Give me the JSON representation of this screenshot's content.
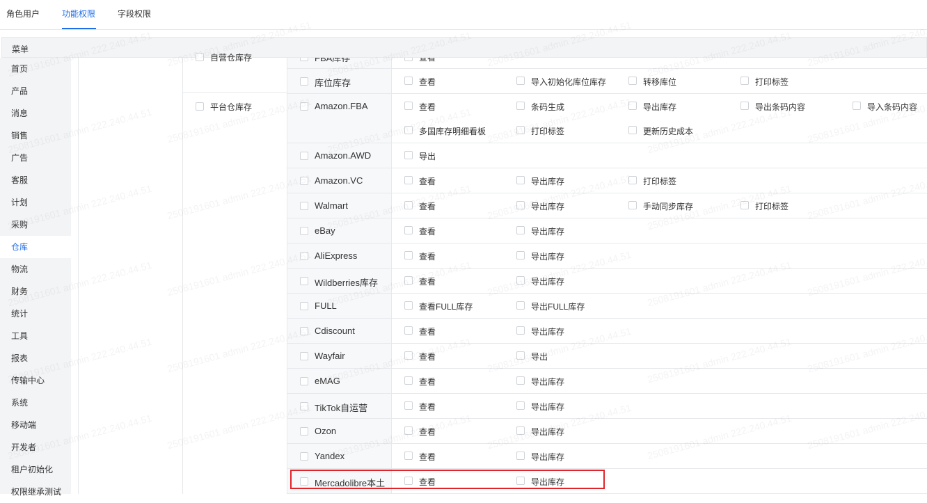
{
  "tabs": [
    {
      "label": "角色用户"
    },
    {
      "label": "功能权限"
    },
    {
      "label": "字段权限"
    }
  ],
  "menu_header": "菜单",
  "sidebar": {
    "items": [
      {
        "label": "首页"
      },
      {
        "label": "产品"
      },
      {
        "label": "消息"
      },
      {
        "label": "销售"
      },
      {
        "label": "广告"
      },
      {
        "label": "客服"
      },
      {
        "label": "计划"
      },
      {
        "label": "采购"
      },
      {
        "label": "仓库"
      },
      {
        "label": "物流"
      },
      {
        "label": "财务"
      },
      {
        "label": "统计"
      },
      {
        "label": "工具"
      },
      {
        "label": "报表"
      },
      {
        "label": "传输中心"
      },
      {
        "label": "系统"
      },
      {
        "label": "移动端"
      },
      {
        "label": "开发者"
      },
      {
        "label": "租户初始化"
      },
      {
        "label": "权限继承测试"
      }
    ],
    "active": "仓库"
  },
  "group_top_label": "自营仓库存",
  "group_platform_label": "平台仓库存",
  "partial_top": {
    "name": "FBA库存",
    "permission": "查看"
  },
  "rows": [
    {
      "name": "库位库存",
      "permissions": [
        "查看",
        "导入初始化库位库存",
        "转移库位",
        "打印标签"
      ]
    },
    {
      "name": "Amazon.FBA",
      "permissions": [
        "查看",
        "条码生成",
        "导出库存",
        "导出条码内容",
        "导入条码内容",
        "多国库存明细看板",
        "打印标签",
        "更新历史成本"
      ]
    },
    {
      "name": "Amazon.AWD",
      "permissions": [
        "导出"
      ]
    },
    {
      "name": "Amazon.VC",
      "permissions": [
        "查看",
        "导出库存",
        "打印标签"
      ]
    },
    {
      "name": "Walmart",
      "permissions": [
        "查看",
        "导出库存",
        "手动同步库存",
        "打印标签"
      ]
    },
    {
      "name": "eBay",
      "permissions": [
        "查看",
        "导出库存"
      ]
    },
    {
      "name": "AliExpress",
      "permissions": [
        "查看",
        "导出库存"
      ]
    },
    {
      "name": "Wildberries库存",
      "permissions": [
        "查看",
        "导出库存"
      ]
    },
    {
      "name": "FULL",
      "permissions": [
        "查看FULL库存",
        "导出FULL库存"
      ]
    },
    {
      "name": "Cdiscount",
      "permissions": [
        "查看",
        "导出库存"
      ]
    },
    {
      "name": "Wayfair",
      "permissions": [
        "查看",
        "导出"
      ]
    },
    {
      "name": "eMAG",
      "permissions": [
        "查看",
        "导出库存"
      ]
    },
    {
      "name": "TikTok自运营",
      "permissions": [
        "查看",
        "导出库存"
      ]
    },
    {
      "name": "Ozon",
      "permissions": [
        "查看",
        "导出库存"
      ]
    },
    {
      "name": "Yandex",
      "permissions": [
        "查看",
        "导出库存"
      ]
    },
    {
      "name": "Mercadolibre本土",
      "permissions": [
        "查看",
        "导出库存"
      ]
    }
  ],
  "watermark": "2508191601 admin 222.240.44.51",
  "colors": {
    "accent": "#1d6ee8",
    "highlight": "#e0252a",
    "sidebar_bg": "#f3f4f6"
  }
}
